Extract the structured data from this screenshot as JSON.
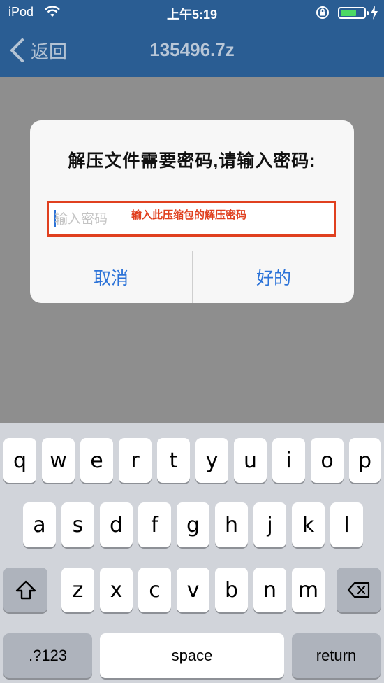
{
  "status": {
    "carrier": "iPod",
    "time": "上午5:19",
    "battery_level": 0.7
  },
  "nav": {
    "back_label": "返回",
    "title": "135496.7z"
  },
  "dialog": {
    "title": "解压文件需要密码,请输入密码:",
    "password_placeholder": "输入密码",
    "annotation": "输入此压缩包的解压密码",
    "cancel_label": "取消",
    "ok_label": "好的"
  },
  "keyboard": {
    "row1": [
      "q",
      "w",
      "e",
      "r",
      "t",
      "y",
      "u",
      "i",
      "o",
      "p"
    ],
    "row2": [
      "a",
      "s",
      "d",
      "f",
      "g",
      "h",
      "j",
      "k",
      "l"
    ],
    "row3": [
      "z",
      "x",
      "c",
      "v",
      "b",
      "n",
      "m"
    ],
    "numbers_label": ".?123",
    "space_label": "space",
    "return_label": "return",
    "icons": [
      "shift-icon",
      "backspace-icon"
    ]
  },
  "colors": {
    "navbar": "#2a5d93",
    "accent": "#2c73d8",
    "annotation": "#e0401f"
  }
}
